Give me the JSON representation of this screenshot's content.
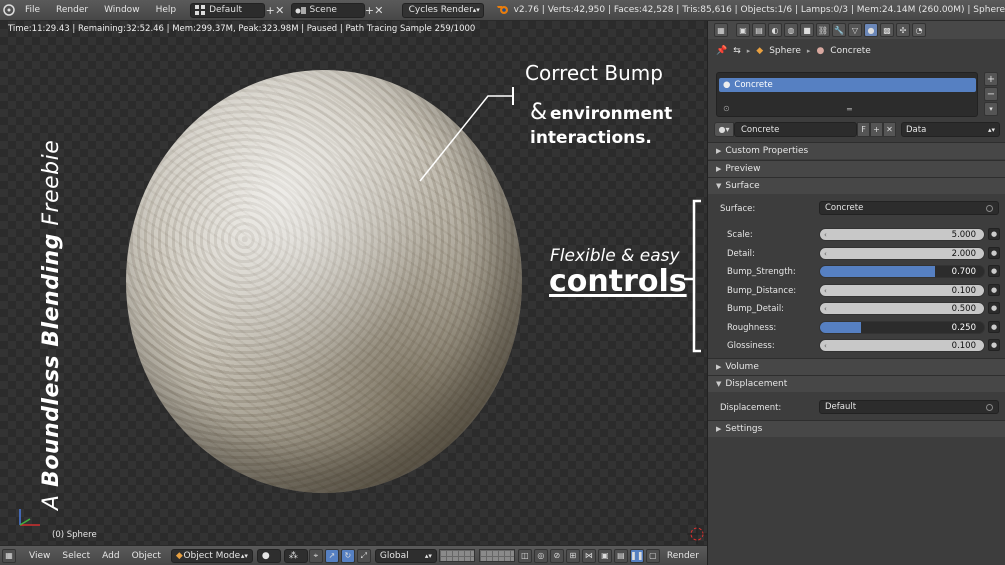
{
  "topbar": {
    "menus": [
      "File",
      "Render",
      "Window",
      "Help"
    ],
    "screen_layout": "Default",
    "scene": "Scene",
    "render_engine": "Cycles Render",
    "stats": "v2.76 | Verts:42,950 | Faces:42,528 | Tris:85,616 | Objects:1/6 | Lamps:0/3 | Mem:24.14M (260.00M) | Sphere"
  },
  "viewport": {
    "render_status": "Time:11:29.43 | Remaining:32:52.46 | Mem:299.37M, Peak:323.98M | Paused | Path Tracing Sample 259/1000",
    "object_label": "(0) Sphere",
    "overlay": {
      "vertical_a": "A ",
      "vertical_bold": "Boundless Blending",
      "vertical_plain": " Freebie",
      "correct_bump": "Correct Bump",
      "amp": "&",
      "environment": "environment",
      "interactions": "interactions.",
      "flexible": "Flexible & easy",
      "controls": "controls"
    }
  },
  "bottombar": {
    "menus": [
      "View",
      "Select",
      "Add",
      "Object"
    ],
    "mode": "Object Mode",
    "orientation": "Global",
    "render_label": "Render"
  },
  "properties": {
    "context": {
      "object": "Sphere",
      "material": "Concrete"
    },
    "material_slot": "Concrete",
    "material_name": "Concrete",
    "fake_user": "F",
    "link": "Data",
    "panels": {
      "custom_properties": "Custom Properties",
      "preview": "Preview",
      "surface": "Surface",
      "volume": "Volume",
      "displacement": "Displacement",
      "settings": "Settings"
    },
    "surface": {
      "label": "Surface:",
      "value": "Concrete",
      "inputs": [
        {
          "label": "Scale:",
          "value": "5.000",
          "fill": 0
        },
        {
          "label": "Detail:",
          "value": "2.000",
          "fill": 0
        },
        {
          "label": "Bump_Strength:",
          "value": "0.700",
          "fill": 0.7
        },
        {
          "label": "Bump_Distance:",
          "value": "0.100",
          "fill": 0
        },
        {
          "label": "Bump_Detail:",
          "value": "0.500",
          "fill": 0
        },
        {
          "label": "Roughness:",
          "value": "0.250",
          "fill": 0.25
        },
        {
          "label": "Glossiness:",
          "value": "0.100",
          "fill": 0
        }
      ]
    },
    "displacement": {
      "label": "Displacement:",
      "value": "Default"
    }
  },
  "colors": {
    "accent": "#5680c2",
    "panel": "#3d3d3d",
    "header": "#474747"
  }
}
